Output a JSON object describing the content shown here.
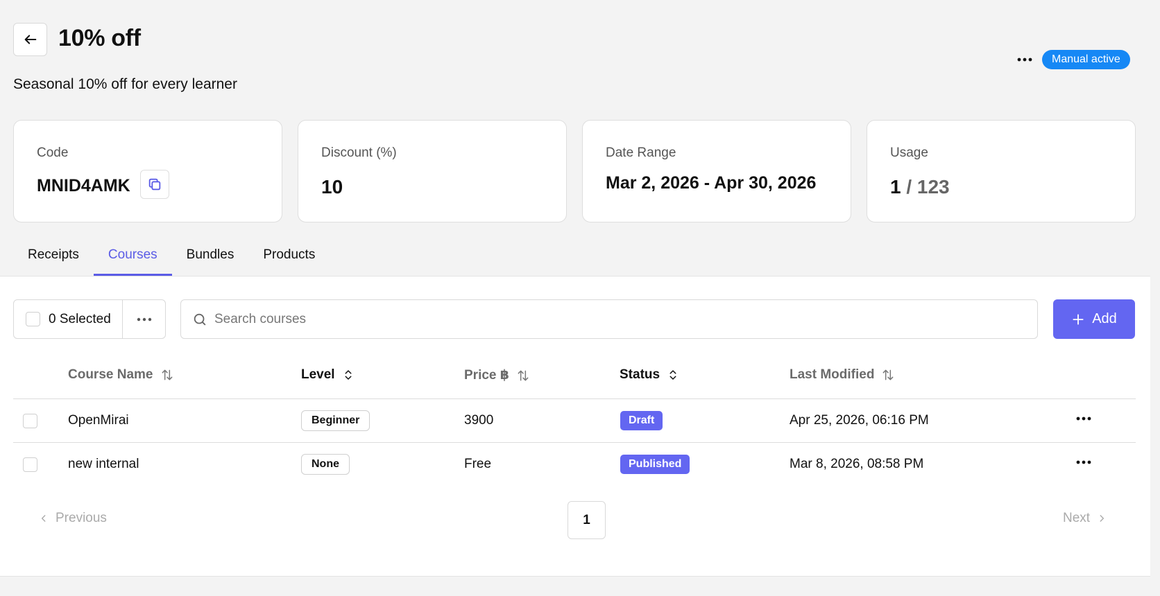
{
  "header": {
    "title": "10% off",
    "subtitle": "Seasonal 10% off for every learner",
    "status_badge": "Manual active"
  },
  "cards": {
    "code": {
      "label": "Code",
      "value": "MNID4AMK"
    },
    "discount": {
      "label": "Discount (%)",
      "value": "10"
    },
    "date_range": {
      "label": "Date Range",
      "value": "Mar 2, 2026 - Apr 30, 2026"
    },
    "usage": {
      "label": "Usage",
      "used": "1",
      "total": " / 123"
    }
  },
  "tabs": [
    {
      "label": "Receipts",
      "active": false
    },
    {
      "label": "Courses",
      "active": true
    },
    {
      "label": "Bundles",
      "active": false
    },
    {
      "label": "Products",
      "active": false
    }
  ],
  "toolbar": {
    "selected_label": "0 Selected",
    "search_placeholder": "Search courses",
    "search_value": "",
    "add_label": "Add"
  },
  "table": {
    "columns": {
      "name": "Course Name",
      "level": "Level",
      "price": "Price ฿",
      "status": "Status",
      "modified": "Last Modified"
    },
    "rows": [
      {
        "name": "OpenMirai",
        "level": "Beginner",
        "price": "3900",
        "status": "Draft",
        "modified": "Apr 25, 2026, 06:16 PM"
      },
      {
        "name": "new internal",
        "level": "None",
        "price": "Free",
        "status": "Published",
        "modified": "Mar 8, 2026, 08:58 PM"
      }
    ]
  },
  "pagination": {
    "prev_label": "Previous",
    "next_label": "Next",
    "current_page": "1"
  },
  "colors": {
    "accent": "#6366f1",
    "status_blue": "#1688f5",
    "background": "#f3f3f3"
  },
  "icons": {
    "back": "arrow-left-icon",
    "more": "ellipsis-icon",
    "copy": "copy-icon",
    "search": "search-icon",
    "add": "plus-icon",
    "sort": "sort-arrows-icon",
    "sort_updown": "chevron-updown-icon",
    "prev": "chevron-left-icon",
    "next": "chevron-right-icon"
  }
}
